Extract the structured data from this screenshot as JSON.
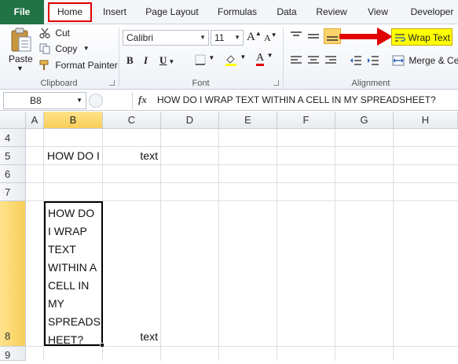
{
  "tabs": {
    "file": "File",
    "home": "Home",
    "insert": "Insert",
    "page_layout": "Page Layout",
    "formulas": "Formulas",
    "data": "Data",
    "review": "Review",
    "view": "View",
    "developer": "Developer"
  },
  "clipboard": {
    "paste": "Paste",
    "cut": "Cut",
    "copy": "Copy",
    "format_painter": "Format Painter",
    "label": "Clipboard"
  },
  "font": {
    "name": "Calibri",
    "size": "11",
    "bold": "B",
    "italic": "I",
    "underline": "U",
    "font_color_glyph": "A",
    "label": "Font"
  },
  "alignment": {
    "wrap_text": "Wrap Text",
    "merge_center": "Merge & Cen",
    "label": "Alignment"
  },
  "formula_bar": {
    "name_box": "B8",
    "fx": "fx",
    "content": "HOW DO I WRAP TEXT WITHIN A CELL IN MY SPREADSHEET?"
  },
  "grid": {
    "columns": [
      "A",
      "B",
      "C",
      "D",
      "E",
      "F",
      "G",
      "H"
    ],
    "rows": [
      "4",
      "5",
      "6",
      "7",
      "8",
      "9"
    ],
    "b5": "HOW DO I",
    "c5": "text",
    "b8": "HOW DO\nI WRAP\nTEXT\nWITHIN A\nCELL IN\nMY\nSPREADS\nHEET?",
    "c8": "text"
  },
  "colors": {
    "file_tab": "#217346",
    "highlight_box": "#e00000",
    "wrap_text_highlight": "#ffff00",
    "arrow": "#e00000",
    "selected_header": "#f8cd58"
  }
}
